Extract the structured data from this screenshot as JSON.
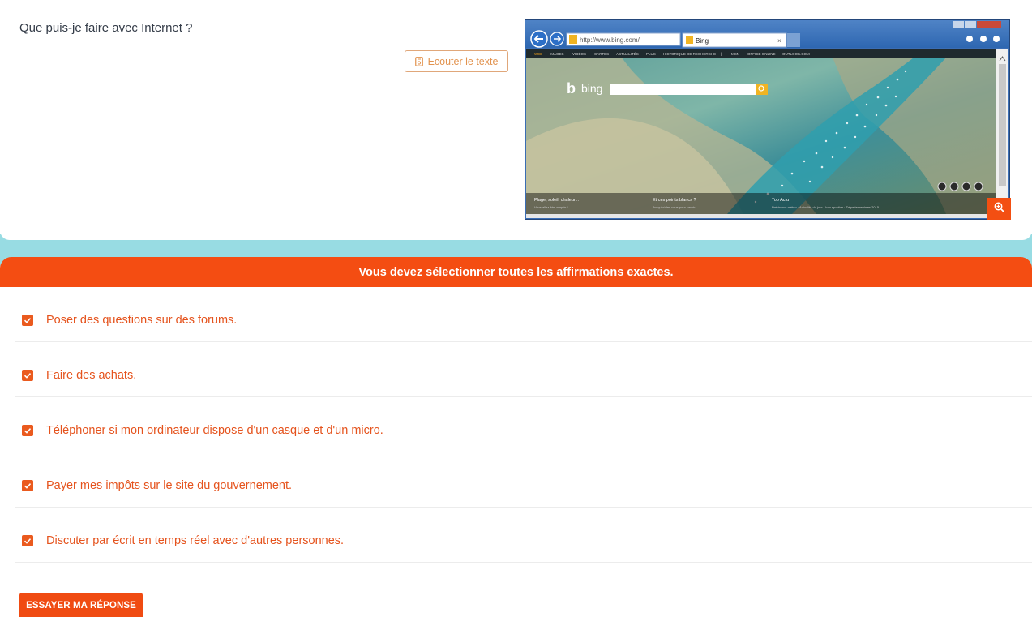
{
  "question": {
    "text": "Que puis-je faire avec Internet ?",
    "listen_label": "Ecouter le texte"
  },
  "browser_screenshot": {
    "address": "http://www.bing.com/",
    "tab_label": "Bing",
    "logo_text": "bing",
    "nav_items": [
      "WEB",
      "IMAGES",
      "VIDÉOS",
      "CARTES",
      "ACTUALITÉS",
      "PLUS",
      "HISTORIQUE DE RECHERCHE",
      "|",
      "MSN",
      "OFFICE ONLINE",
      "OUTLOOK.COM"
    ],
    "footer_items": [
      {
        "title": "Plage, soleil, chaleur...",
        "sub": "Vous allez être surpris !"
      },
      {
        "title": "Et ces points blancs ?",
        "sub": "Jusqu'où les vous pour savoir..."
      },
      {
        "title": "Top Actu",
        "sub": "Prévisions météo · Actualité du jour · Info sportive · Départementales 2015"
      }
    ]
  },
  "instruction": {
    "text": "Vous devez sélectionner toutes les affirmations exactes."
  },
  "answers": [
    {
      "label": "Poser des questions sur des forums.",
      "checked": true
    },
    {
      "label": "Faire des achats.",
      "checked": true
    },
    {
      "label": "Téléphoner si mon ordinateur dispose d'un casque et d'un micro.",
      "checked": true
    },
    {
      "label": "Payer mes impôts sur le site du gouvernement.",
      "checked": true
    },
    {
      "label": "Discuter par écrit en temps réel avec d'autres personnes.",
      "checked": true
    }
  ],
  "submit": {
    "label": "ESSAYER MA RÉPONSE"
  },
  "colors": {
    "accent": "#f44d12",
    "teal": "#98dce3",
    "answer_text": "#e5531d"
  },
  "icons": {
    "listen": "document-audio-icon",
    "zoom": "zoom-in-icon",
    "checkbox": "checkbox-checked-icon"
  }
}
